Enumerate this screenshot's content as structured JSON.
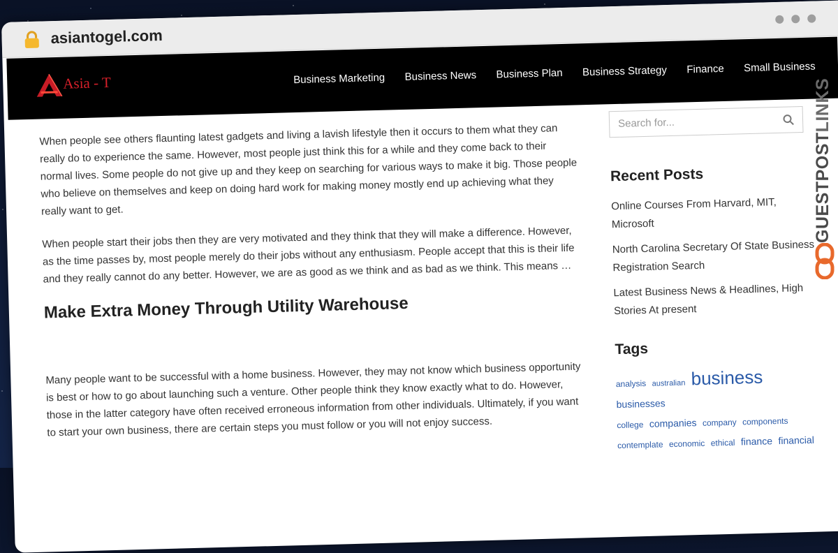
{
  "browser": {
    "url": "asiantogel.com"
  },
  "site": {
    "logo_text": "Asia - T",
    "nav": [
      "Business Marketing",
      "Business News",
      "Business Plan",
      "Business Strategy",
      "Finance",
      "Small Business"
    ]
  },
  "content": {
    "paragraph_1": "When people see others flaunting latest gadgets and living a lavish lifestyle then it occurs to them what they can really do to experience the same. However, most people just think this for a while and they come back to their normal lives. Some people do not give up and they keep on searching for various ways to make it big. Those people who believe on themselves and keep on doing hard work for making money mostly end up achieving what they really want to get.",
    "paragraph_2": "When people start their jobs then they are very motivated and they think that they will make a difference. However, as the time passes by, most people merely do their jobs without any enthusiasm. People accept that this is their life and they really cannot do any better. However, we are as good as we think and as bad as we think. This means …",
    "heading": "Make Extra Money Through Utility Warehouse",
    "paragraph_3": "Many people want to be successful with a home business. However, they may not know which business opportunity is best or how to go about launching such a venture. Other people think they know exactly what to do. However, those in the latter category have often received erroneous information from other individuals. Ultimately, if you want to start your own business, there are certain steps you must follow or you will not enjoy success."
  },
  "sidebar": {
    "search_placeholder": "Search for...",
    "recent_title": "Recent Posts",
    "recent_posts": [
      "Online Courses From Harvard, MIT, Microsoft",
      "North Carolina Secretary Of State Business Registration Search",
      "Latest Business News & Headlines, High Stories At present"
    ],
    "tags_title": "Tags",
    "tags": [
      "analysis",
      "australian",
      "business",
      "businesses",
      "college",
      "companies",
      "company",
      "components",
      "contemplate",
      "economic",
      "ethical",
      "finance",
      "financial"
    ]
  },
  "watermark": {
    "brand_part_1": "GUESTPOST",
    "brand_part_2": "LINKS"
  },
  "colors": {
    "header_bg": "#000000",
    "logo_red": "#d6202a",
    "tag_blue": "#2a5aa8",
    "brand_orange": "#e8692c"
  }
}
